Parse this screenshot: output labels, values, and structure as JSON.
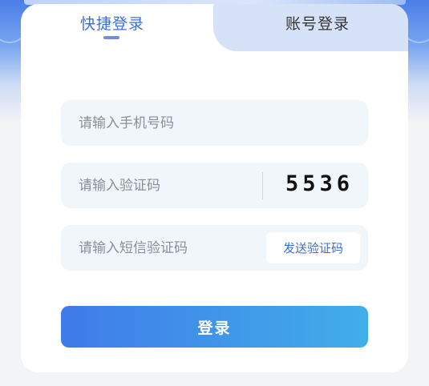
{
  "tabs": {
    "quick_login": "快捷登录",
    "account_login": "账号登录",
    "active": "quick_login"
  },
  "form": {
    "phone_placeholder": "请输入手机号码",
    "captcha_placeholder": "请输入验证码",
    "captcha_code": "5536",
    "sms_placeholder": "请输入短信验证码",
    "send_code_label": "发送验证码",
    "login_label": "登录"
  },
  "colors": {
    "accent": "#3c6fd6",
    "button_gradient_start": "#3f7be9",
    "button_gradient_end": "#41aee9",
    "field_bg": "#f1f6fb",
    "inactive_tab_bg": "#d6e2f8"
  }
}
